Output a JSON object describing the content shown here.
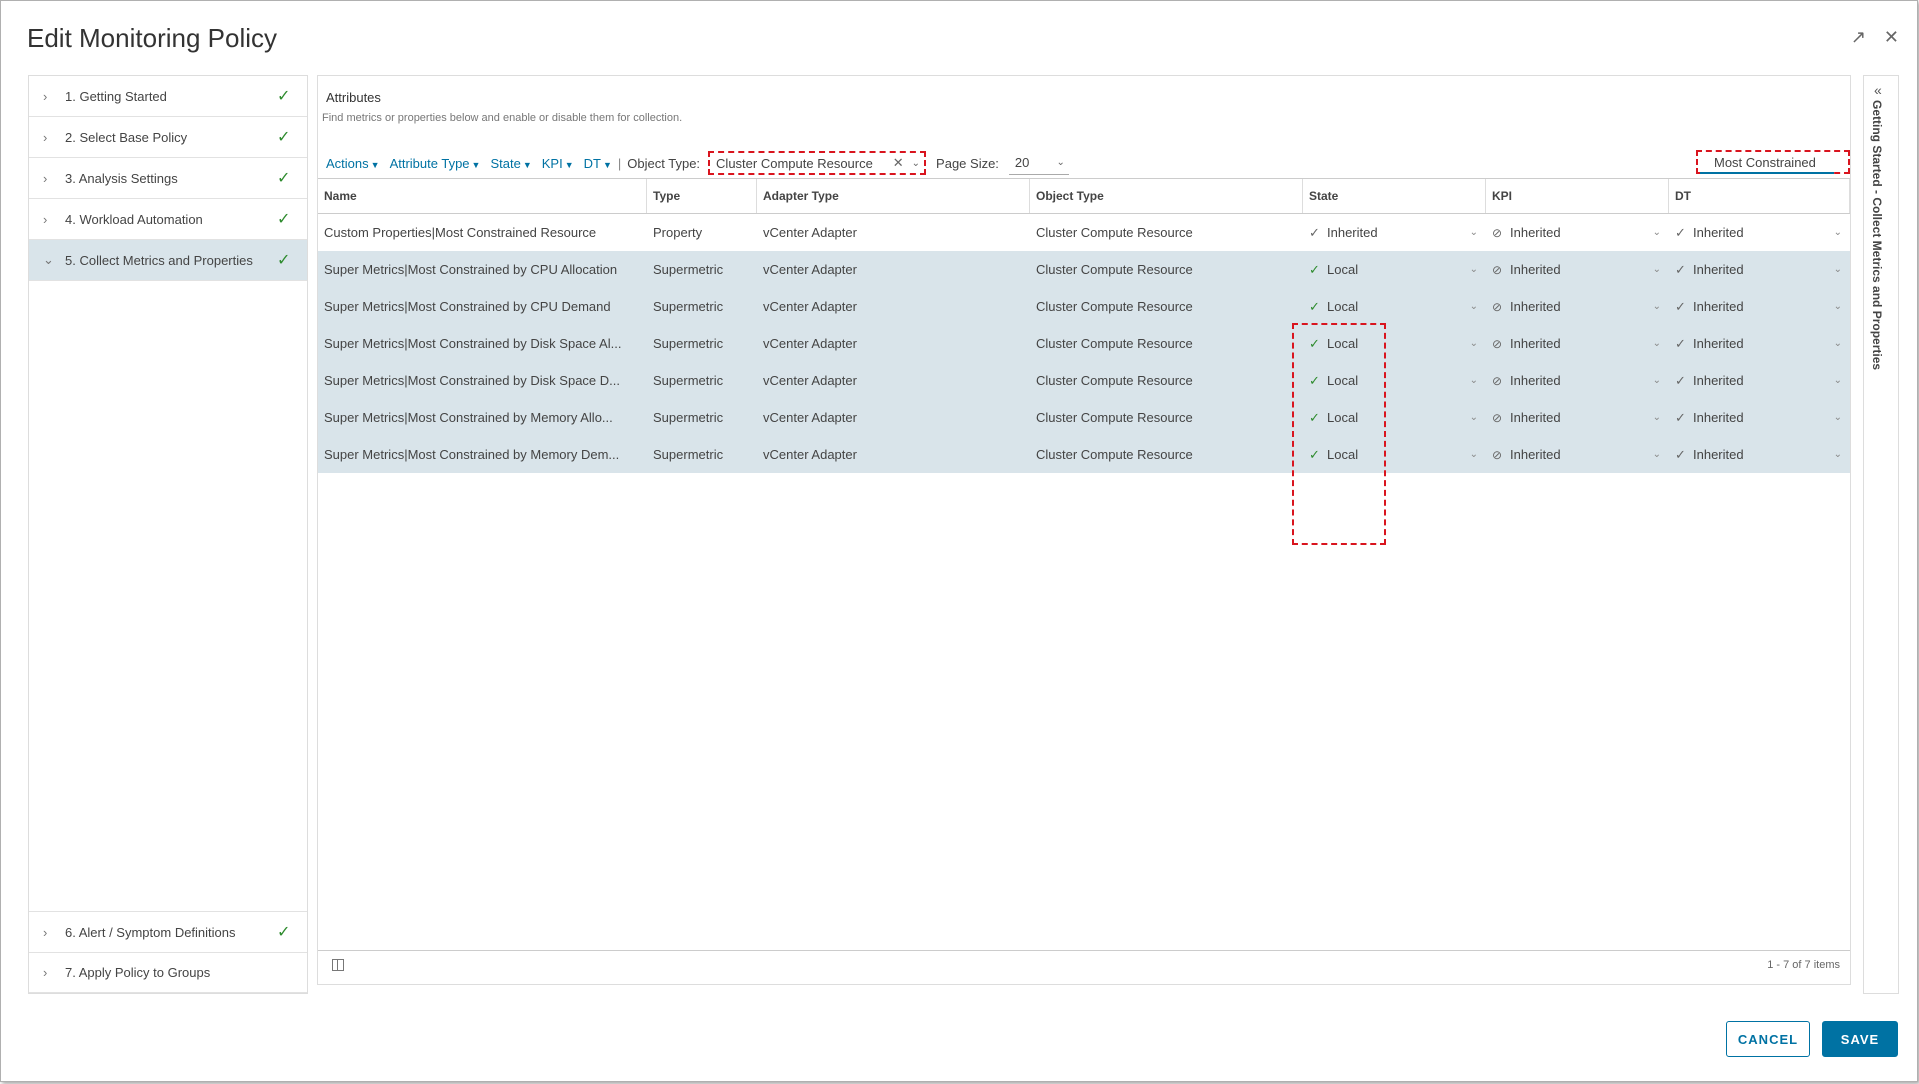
{
  "dialog": {
    "title": "Edit Monitoring Policy"
  },
  "steps": [
    {
      "label": "1. Getting Started",
      "done": true
    },
    {
      "label": "2. Select Base Policy",
      "done": true
    },
    {
      "label": "3. Analysis Settings",
      "done": true
    },
    {
      "label": "4. Workload Automation",
      "done": true
    },
    {
      "label": "5. Collect Metrics and Properties",
      "done": true,
      "active": true
    },
    {
      "label": "6. Alert / Symptom Definitions",
      "done": true
    },
    {
      "label": "7. Apply Policy to Groups",
      "done": false
    }
  ],
  "attributes": {
    "title": "Attributes",
    "description": "Find metrics or properties below and enable or disable them for collection."
  },
  "toolbar": {
    "actions": "Actions",
    "attribute_type": "Attribute Type",
    "state": "State",
    "kpi": "KPI",
    "dt": "DT",
    "object_type_label": "Object Type:",
    "object_type_value": "Cluster Compute Resource",
    "page_size_label": "Page Size:",
    "page_size_value": "20",
    "search_value": "Most Constrained"
  },
  "grid": {
    "columns": [
      "Name",
      "Type",
      "Adapter Type",
      "Object Type",
      "State",
      "KPI",
      "DT"
    ],
    "rows": [
      {
        "name": "Custom Properties|Most Constrained Resource",
        "type": "Property",
        "adapter": "vCenter Adapter",
        "object": "Cluster Compute Resource",
        "state": "Inherited",
        "kpi": "Inherited",
        "dt": "Inherited",
        "selected": false
      },
      {
        "name": "Super Metrics|Most Constrained by CPU Allocation",
        "type": "Supermetric",
        "adapter": "vCenter Adapter",
        "object": "Cluster Compute Resource",
        "state": "Local",
        "kpi": "Inherited",
        "dt": "Inherited",
        "selected": true
      },
      {
        "name": "Super Metrics|Most Constrained by CPU Demand",
        "type": "Supermetric",
        "adapter": "vCenter Adapter",
        "object": "Cluster Compute Resource",
        "state": "Local",
        "kpi": "Inherited",
        "dt": "Inherited",
        "selected": true
      },
      {
        "name": "Super Metrics|Most Constrained by Disk Space Al...",
        "type": "Supermetric",
        "adapter": "vCenter Adapter",
        "object": "Cluster Compute Resource",
        "state": "Local",
        "kpi": "Inherited",
        "dt": "Inherited",
        "selected": true
      },
      {
        "name": "Super Metrics|Most Constrained by Disk Space D...",
        "type": "Supermetric",
        "adapter": "vCenter Adapter",
        "object": "Cluster Compute Resource",
        "state": "Local",
        "kpi": "Inherited",
        "dt": "Inherited",
        "selected": true
      },
      {
        "name": "Super Metrics|Most Constrained by Memory Allo...",
        "type": "Supermetric",
        "adapter": "vCenter Adapter",
        "object": "Cluster Compute Resource",
        "state": "Local",
        "kpi": "Inherited",
        "dt": "Inherited",
        "selected": true
      },
      {
        "name": "Super Metrics|Most Constrained by Memory Dem...",
        "type": "Supermetric",
        "adapter": "vCenter Adapter",
        "object": "Cluster Compute Resource",
        "state": "Local",
        "kpi": "Inherited",
        "dt": "Inherited",
        "selected": true
      }
    ],
    "footer_count": "1 - 7 of 7 items"
  },
  "side_panel": {
    "text": "Getting Started - Collect Metrics and Properties"
  },
  "buttons": {
    "cancel": "CANCEL",
    "save": "SAVE"
  },
  "colors": {
    "accent": "#0072a3",
    "check": "#2e8b2e",
    "highlight": "#d9141e",
    "selected_row": "#d9e4ea"
  },
  "icons": {
    "close": "close-icon",
    "pin": "pin-icon",
    "check": "check-icon",
    "ban": "ban-icon",
    "chevron_right": "chevron-right-icon",
    "chevron_down": "chevron-down-icon",
    "double_chevron_left": "double-chevron-left-icon"
  }
}
